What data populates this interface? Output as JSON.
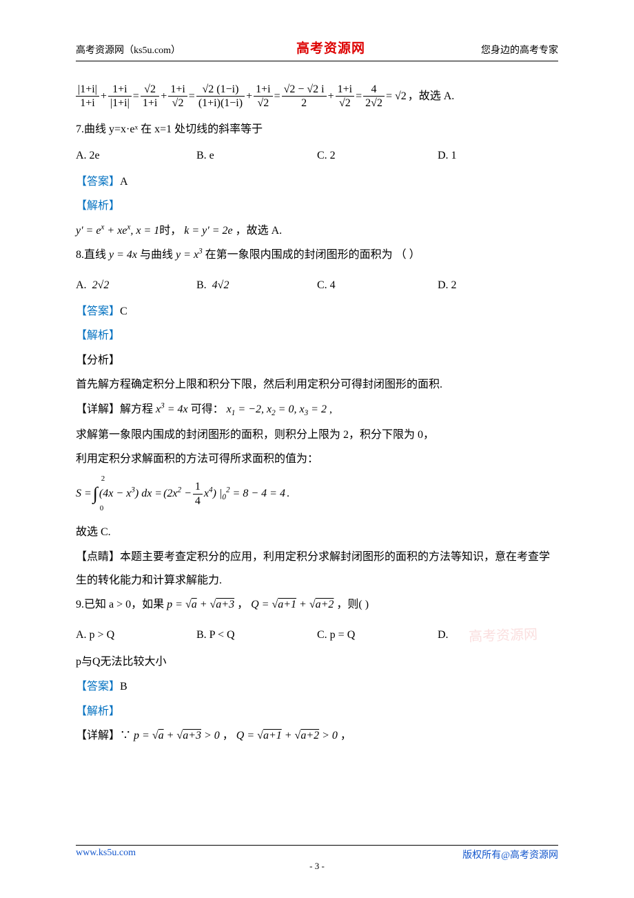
{
  "header": {
    "left": "高考资源网（ks5u.com）",
    "center": "高考资源网",
    "right": "您身边的高考专家"
  },
  "eq6": {
    "tail": "，故选 A."
  },
  "q7": {
    "stem": "7.曲线 y=x·eˣ 在 x=1 处切线的斜率等于",
    "A": "A. 2e",
    "B": "B. e",
    "C": "C. 2",
    "D": "D. 1",
    "ans_label": "【答案】",
    "ans": "A",
    "ana_label": "【解析】",
    "work": "y' = eˣ + xeˣ, x = 1时， k = y' = 2e ，故选 A."
  },
  "q8": {
    "stem_pre": "8.直线 ",
    "stem_eq1": "y = 4x",
    "stem_mid": " 与曲线 ",
    "stem_eq2": "y = x³",
    "stem_post": " 在第一象限内围成的封闭图形的面积为 （   ）",
    "A": "A.  2√2",
    "B": "B.  4√2",
    "C": "C. 4",
    "D": "D.  2",
    "ans_label": "【答案】",
    "ans": "C",
    "ana_label": "【解析】",
    "fx_label": "【分析】",
    "fx_text": "首先解方程确定积分上限和积分下限，然后利用定积分可得封闭图形的面积.",
    "detail_label": "【详解】",
    "detail1_pre": "解方程 ",
    "detail1_eq": "x³ = 4x",
    "detail1_mid": " 可得： ",
    "detail1_roots": "x₁ = −2, x₂ = 0, x₃ = 2",
    "detail1_post": " ,",
    "detail2": "求解第一象限内围成的封闭图形的面积，则积分上限为 2，积分下限为 0，",
    "detail3": "利用定积分求解面积的方法可得所求面积的值为：",
    "integral_tail": " .",
    "conclude": "故选 C.",
    "ds_label": "【点睛】",
    "ds_text": "本题主要考查定积分的应用，利用定积分求解封闭图形的面积的方法等知识，意在考查学生的转化能力和计算求解能力."
  },
  "q9": {
    "stem_pre": "9.已知 a > 0，如果 ",
    "stem_p": "p = √a + √(a+3)",
    "stem_mid": "， ",
    "stem_q": "Q = √(a+1) + √(a+2)",
    "stem_post": "，则(        )",
    "A": "A.  p > Q",
    "B": "B.   P < Q",
    "C": "C.   p = Q",
    "D": "D.",
    "Dline2": "p与Q无法比较大小",
    "ans_label": "【答案】",
    "ans": "B",
    "ana_label": "【解析】",
    "detail_label": "【详解】",
    "detail_pre": "∵ ",
    "detail_p": "p = √a + √(a+3) > 0",
    "detail_mid": " ， ",
    "detail_q": "Q = √(a+1) + √(a+2) > 0",
    "detail_post": " ，"
  },
  "watermark": "高考资源网",
  "footer": {
    "left": "www.ks5u.com",
    "right": "版权所有@高考资源网",
    "page": "- 3 -"
  }
}
